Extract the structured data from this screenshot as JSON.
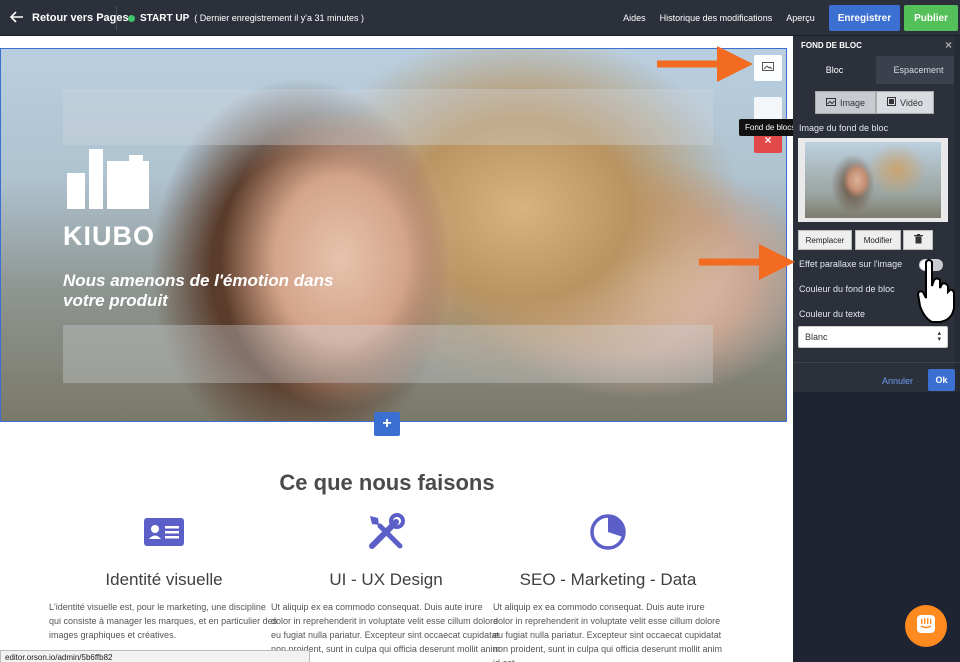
{
  "topbar": {
    "back_label": "Retour vers Pages",
    "site_name": "START UP",
    "save_status": "( Dernier enregistrement il y'a 31 minutes )",
    "links": [
      "Aides",
      "Historique des modifications",
      "Aperçu"
    ],
    "save_label": "Enregistrer",
    "publish_label": "Publier"
  },
  "hero": {
    "logo_text": "KIUBO",
    "tagline": "Nous amenons de l'émotion dans votre produit",
    "tooltip": "Fond de blocs",
    "delete_glyph": "×",
    "add_glyph": "+"
  },
  "section": {
    "title": "Ce que nous faisons",
    "columns": [
      {
        "title": "Identité visuelle",
        "text": "L'identité visuelle est, pour le marketing, une discipline qui consiste à manager les marques, et en particulier des images graphiques et créatives."
      },
      {
        "title": "UI - UX Design",
        "text": "Ut aliquip ex ea commodo consequat. Duis aute irure dolor in reprehenderit in voluptate velit esse cillum dolore eu fugiat nulla pariatur. Excepteur sint occaecat cupidatat non proident, sunt in culpa qui officia deserunt mollit anim id est"
      },
      {
        "title": "SEO - Marketing - Data",
        "text": "Ut aliquip ex ea commodo consequat. Duis aute irure dolor in reprehenderit in voluptate velit esse cillum dolore eu fugiat nulla pariatur. Excepteur sint occaecat cupidatat non proident, sunt in culpa qui officia deserunt mollit anim id est"
      }
    ]
  },
  "status_url": "editor.orson.io/admin/5b6ffb82",
  "panel": {
    "title": "FOND DE BLOC",
    "close_glyph": "×",
    "tabs": [
      "Bloc",
      "Espacement"
    ],
    "media_options": [
      "Image",
      "Vidéo"
    ],
    "image_label": "Image du fond de bloc",
    "buttons": {
      "replace": "Remplacer",
      "edit": "Modifier"
    },
    "parallax_label": "Effet parallaxe sur l'image",
    "bg_color_label": "Couleur du fond de bloc",
    "text_color_label": "Couleur du texte",
    "text_color_value": "Blanc",
    "cancel_label": "Annuler",
    "ok_label": "Ok"
  },
  "colors": {
    "accent_blue": "#3b6fd1",
    "publish_green": "#54c05a",
    "delete_red": "#e24a4a",
    "icon_purple": "#5b5fc7",
    "arrow_orange": "#f26b21",
    "chat_orange": "#ff8a1f"
  }
}
